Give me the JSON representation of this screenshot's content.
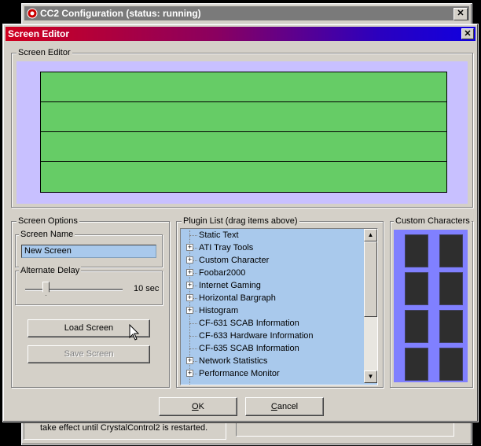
{
  "back_window": {
    "title": "CC2 Configuration (status: running)",
    "close_label": "✕",
    "bottom_text": "take effect until CrystalControl2 is restarted."
  },
  "dialog": {
    "title": "Screen Editor",
    "close_label": "✕",
    "screen_editor": {
      "label": "Screen Editor",
      "rows": 4
    },
    "screen_options": {
      "label": "Screen Options",
      "screen_name_label": "Screen Name",
      "screen_name_value": "New Screen",
      "alternate_delay_label": "Alternate Delay",
      "alternate_delay_value": "10 sec",
      "load_button": "Load Screen",
      "save_button": "Save Screen"
    },
    "plugin_list": {
      "label": "Plugin List (drag items above)",
      "items": [
        {
          "label": "Static Text",
          "expandable": false
        },
        {
          "label": "ATI Tray Tools",
          "expandable": true
        },
        {
          "label": "Custom Character",
          "expandable": true
        },
        {
          "label": "Foobar2000",
          "expandable": true
        },
        {
          "label": "Internet Gaming",
          "expandable": true
        },
        {
          "label": "Horizontal Bargraph",
          "expandable": true
        },
        {
          "label": "Histogram",
          "expandable": true
        },
        {
          "label": "CF-631 SCAB Information",
          "expandable": false
        },
        {
          "label": "CF-633 Hardware Information",
          "expandable": false
        },
        {
          "label": "CF-635 SCAB Information",
          "expandable": false
        },
        {
          "label": "Network Statistics",
          "expandable": true
        },
        {
          "label": "Performance Monitor",
          "expandable": true
        }
      ]
    },
    "custom_characters": {
      "label": "Custom Characters",
      "count": 8
    },
    "ok_button": {
      "underlined": "O",
      "rest": "K"
    },
    "cancel_button": {
      "underlined": "C",
      "rest": "ancel"
    }
  },
  "colors": {
    "title_gradient_start": "#d0001e",
    "title_gradient_end": "#1000e0",
    "lcd_background": "#66cc66",
    "lcd_bezel": "#c8c0ff",
    "list_background": "#a9c9ec",
    "custom_char_background": "#8080ff"
  }
}
